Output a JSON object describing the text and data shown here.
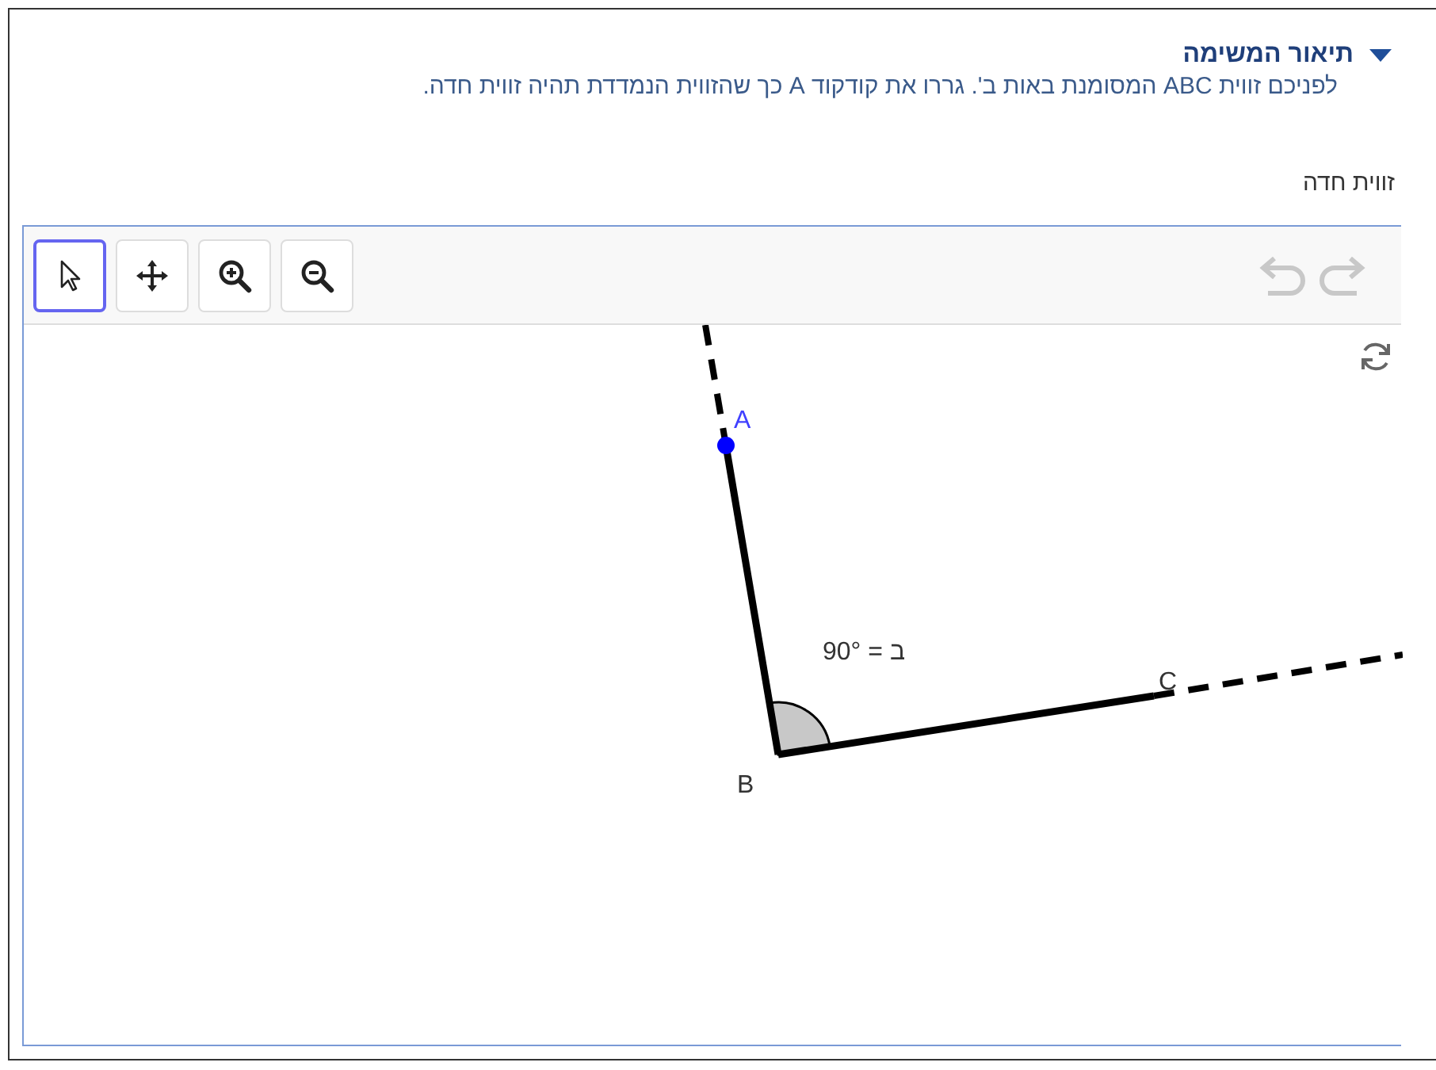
{
  "task": {
    "title": "תיאור המשימה",
    "expanded": true,
    "description": "לפניכם זווית ABC המסומנת באות ב'. גררו את קודקוד A כך שהזווית הנמדדת תהיה זווית חדה."
  },
  "answer_label": "זווית חדה",
  "applet": {
    "tools": [
      {
        "kind": "select",
        "selected": true
      },
      {
        "kind": "move",
        "selected": false
      },
      {
        "kind": "zoom-in",
        "selected": false
      },
      {
        "kind": "zoom-out",
        "selected": false
      }
    ],
    "undo": {
      "disabled": true
    },
    "redo": {
      "disabled": true
    },
    "points": [
      {
        "label": "A",
        "draggable": true
      },
      {
        "label": "B",
        "draggable": false
      },
      {
        "label": "C",
        "draggable": false
      }
    ],
    "angle_label": "ב = 90°"
  }
}
